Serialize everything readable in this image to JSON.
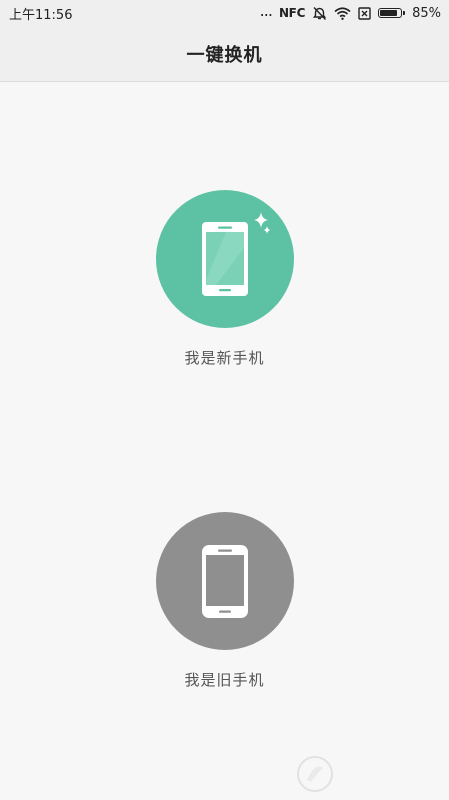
{
  "status_bar": {
    "time": "上午11:56",
    "dots": "...",
    "nfc": "NFC",
    "battery_percent": "85%",
    "battery_level": 0.85,
    "icons": [
      "alarm-off-icon",
      "wifi-icon",
      "sim-x-icon",
      "battery-icon"
    ]
  },
  "header": {
    "title": "一键换机"
  },
  "options": {
    "new_phone": {
      "label": "我是新手机",
      "icon": "new-phone-icon",
      "color": "#5cc2a3"
    },
    "old_phone": {
      "label": "我是旧手机",
      "icon": "old-phone-icon",
      "color": "#8f8f8f"
    }
  }
}
